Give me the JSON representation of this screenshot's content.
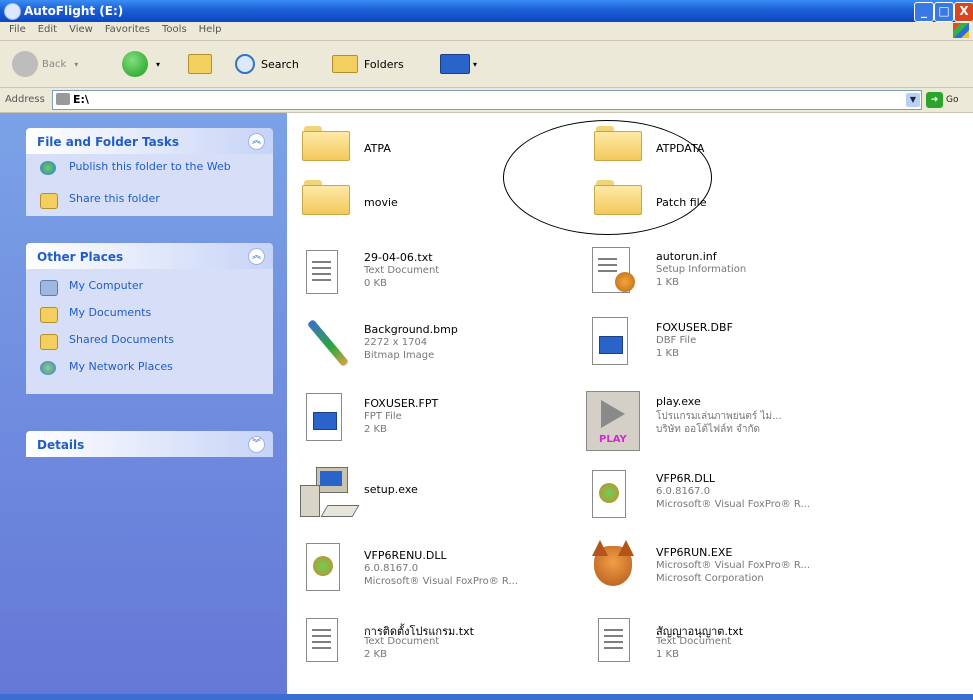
{
  "window": {
    "title": "AutoFlight (E:)",
    "minimize": "_",
    "maximize": "□",
    "close": "X"
  },
  "menu": [
    "File",
    "Edit",
    "View",
    "Favorites",
    "Tools",
    "Help"
  ],
  "toolbar": {
    "back_label": "Back",
    "search_label": "Search",
    "folders_label": "Folders"
  },
  "address": {
    "label": "Address",
    "value": "E:\\",
    "go_label": "Go"
  },
  "left_pane": {
    "file_tasks": {
      "title": "File and Folder Tasks",
      "items": [
        {
          "label": "Publish this folder to the Web",
          "icon": "globe-icon"
        },
        {
          "label": "Share this folder",
          "icon": "share-folder-icon"
        }
      ]
    },
    "other_places": {
      "title": "Other Places",
      "items": [
        {
          "label": "My Computer",
          "icon": "computer-icon"
        },
        {
          "label": "My Documents",
          "icon": "documents-icon"
        },
        {
          "label": "Shared Documents",
          "icon": "shared-folder-icon"
        },
        {
          "label": "My Network Places",
          "icon": "network-icon"
        }
      ]
    },
    "details": {
      "title": "Details"
    }
  },
  "files": [
    {
      "name": "ATPA",
      "type": "folder"
    },
    {
      "name": "ATPDATA",
      "type": "folder"
    },
    {
      "name": "movie",
      "type": "folder"
    },
    {
      "name": "Patch file",
      "type": "folder"
    },
    {
      "name": "29-04-06.txt",
      "line2": "Text Document",
      "line3": "0 KB",
      "type": "text"
    },
    {
      "name": "autorun.inf",
      "line2": "Setup Information",
      "line3": "1 KB",
      "type": "setup"
    },
    {
      "name": "Background.bmp",
      "line2": "2272 x 1704",
      "line3": "Bitmap Image",
      "type": "bitmap"
    },
    {
      "name": "FOXUSER.DBF",
      "line2": "DBF File",
      "line3": "1 KB",
      "type": "dbf"
    },
    {
      "name": "FOXUSER.FPT",
      "line2": "FPT File",
      "line3": "2 KB",
      "type": "fpt"
    },
    {
      "name": "play.exe",
      "line2": "โปรแกรมเล่นภาพยนตร์ ไม่...",
      "line3": "บริษัท ออโต้ไฟล์ท จำกัด",
      "type": "play",
      "badge": "PLAY"
    },
    {
      "name": "setup.exe",
      "type": "setupexe"
    },
    {
      "name": "VFP6R.DLL",
      "line2": "6.0.8167.0",
      "line3": "Microsoft® Visual FoxPro® R...",
      "type": "dll"
    },
    {
      "name": "VFP6RENU.DLL",
      "line2": "6.0.8167.0",
      "line3": "Microsoft® Visual FoxPro® R...",
      "type": "dll"
    },
    {
      "name": "VFP6RUN.EXE",
      "line2": "Microsoft® Visual FoxPro® R...",
      "line3": "Microsoft Corporation",
      "type": "fox"
    },
    {
      "name": "การติดตั้งโปรแกรม.txt",
      "line2": "Text Document",
      "line3": "2 KB",
      "type": "text"
    },
    {
      "name": "สัญญาอนุญาต.txt",
      "line2": "Text Document",
      "line3": "1 KB",
      "type": "text"
    }
  ]
}
